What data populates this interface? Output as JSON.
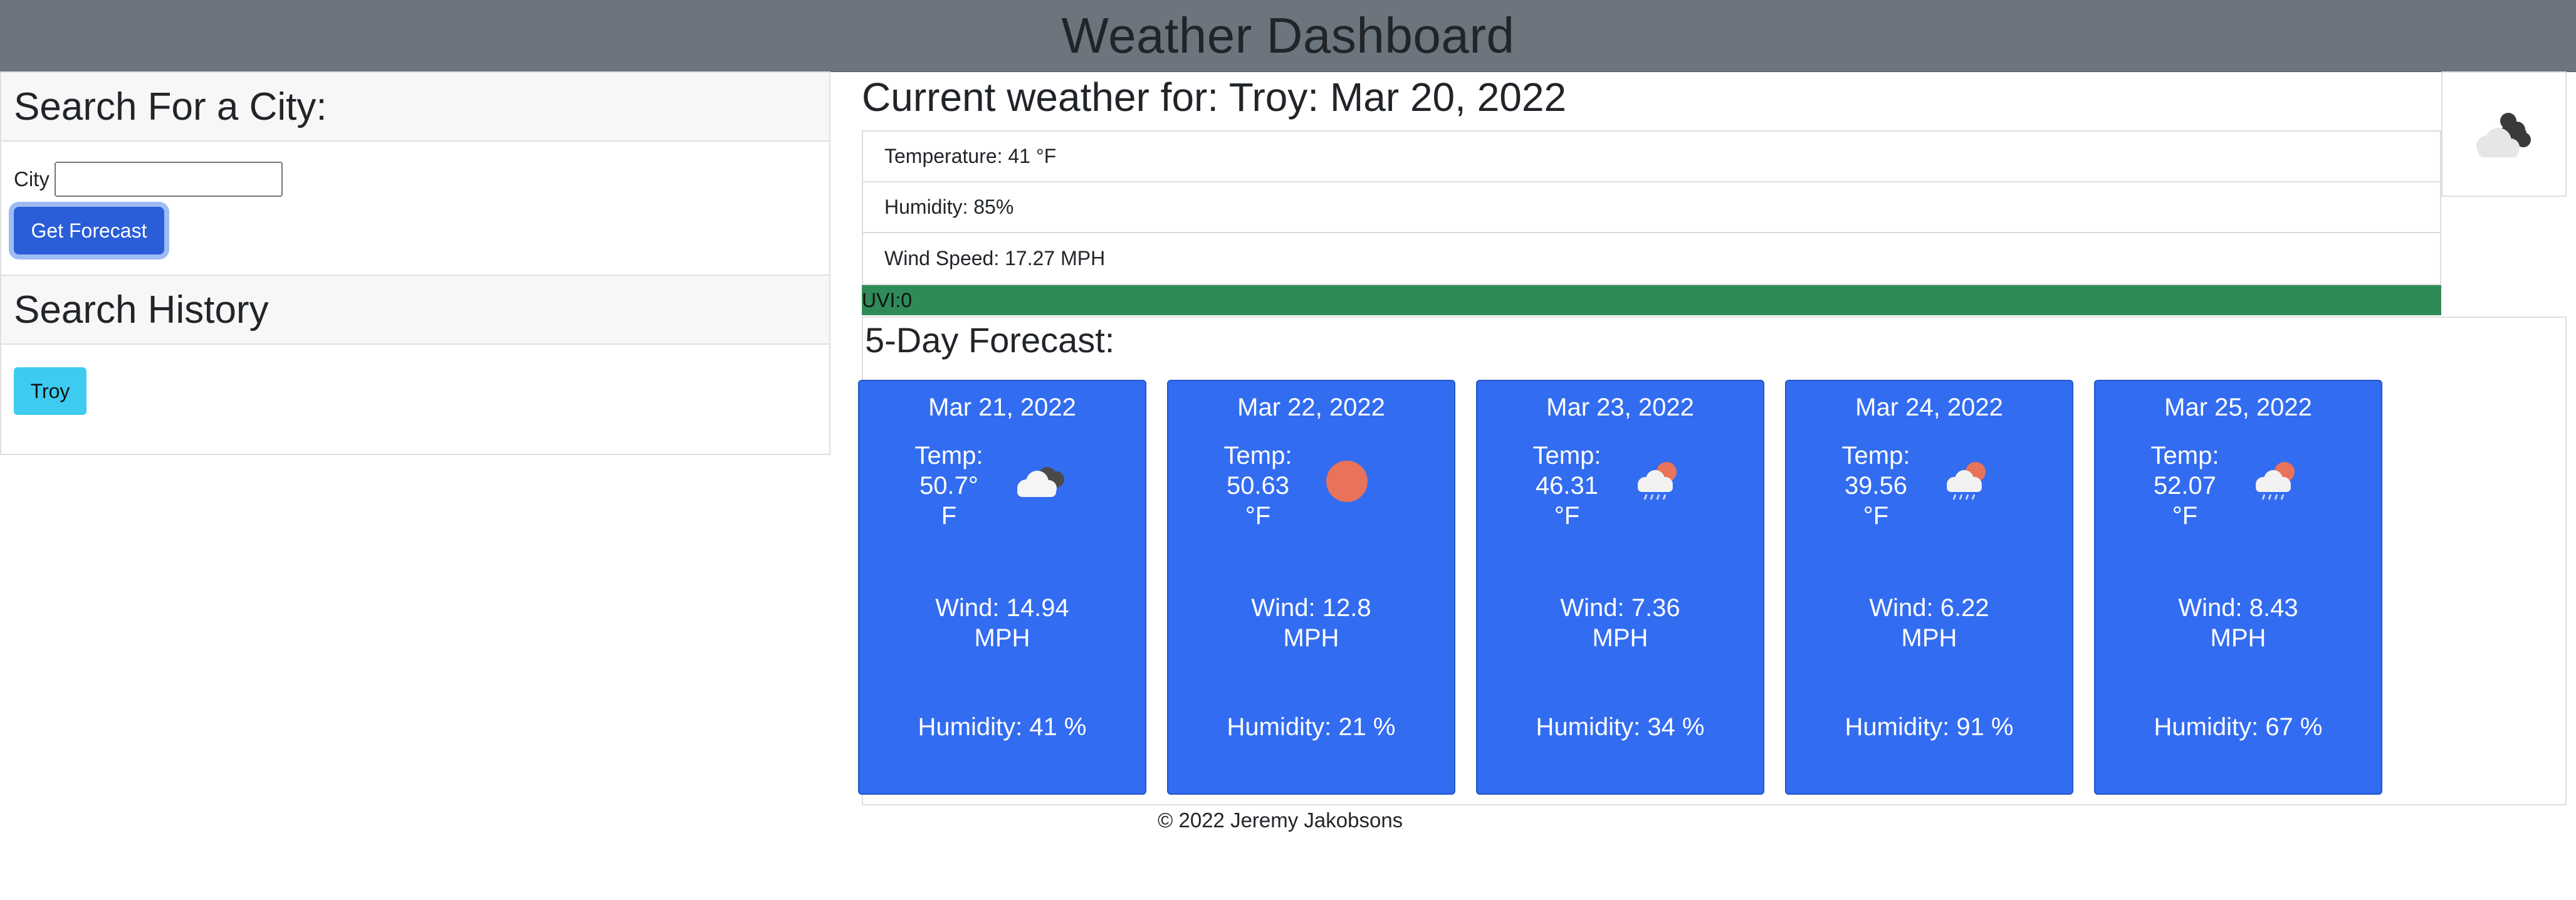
{
  "header": {
    "title": "Weather Dashboard"
  },
  "search": {
    "heading": "Search For a City:",
    "city_label": "City",
    "city_value": "",
    "button_label": "Get Forecast"
  },
  "history": {
    "heading": "Search History",
    "items": [
      "Troy"
    ]
  },
  "current": {
    "title": "Current weather for: Troy: Mar 20, 2022",
    "temperature": "Temperature: 41 °F",
    "humidity": "Humidity: 85%",
    "wind": "Wind Speed: 17.27 MPH",
    "uvi": "UVI:0",
    "uvi_color": "#2e8b57",
    "icon": "cloudy-night-icon"
  },
  "forecast": {
    "heading": "5-Day Forecast:",
    "days": [
      {
        "date": "Mar 21, 2022",
        "temp_label": "Temp:",
        "temp_value": "50.7°",
        "temp_unit": "F",
        "icon": "cloudy-icon",
        "wind_value": "Wind: 14.94",
        "wind_unit": "MPH",
        "humidity": "Humidity: 41 %"
      },
      {
        "date": "Mar 22, 2022",
        "temp_label": "Temp:",
        "temp_value": "50.63",
        "temp_unit": "°F",
        "icon": "sun-icon",
        "wind_value": "Wind: 12.8",
        "wind_unit": "MPH",
        "humidity": "Humidity: 21 %"
      },
      {
        "date": "Mar 23, 2022",
        "temp_label": "Temp:",
        "temp_value": "46.31",
        "temp_unit": "°F",
        "icon": "rain-icon",
        "wind_value": "Wind: 7.36",
        "wind_unit": "MPH",
        "humidity": "Humidity: 34 %"
      },
      {
        "date": "Mar 24, 2022",
        "temp_label": "Temp:",
        "temp_value": "39.56",
        "temp_unit": "°F",
        "icon": "rain-icon",
        "wind_value": "Wind: 6.22",
        "wind_unit": "MPH",
        "humidity": "Humidity: 91 %"
      },
      {
        "date": "Mar 25, 2022",
        "temp_label": "Temp:",
        "temp_value": "52.07",
        "temp_unit": "°F",
        "icon": "rain-icon",
        "wind_value": "Wind: 8.43",
        "wind_unit": "MPH",
        "humidity": "Humidity: 67 %"
      }
    ]
  },
  "footer": {
    "text": "© 2022 Jeremy Jakobsons"
  },
  "colors": {
    "header_bg": "#6c757d",
    "card_bg": "#326cf0",
    "button_primary": "#2a5dd8",
    "button_history": "#3dcbf0",
    "sun": "#e8735a"
  }
}
